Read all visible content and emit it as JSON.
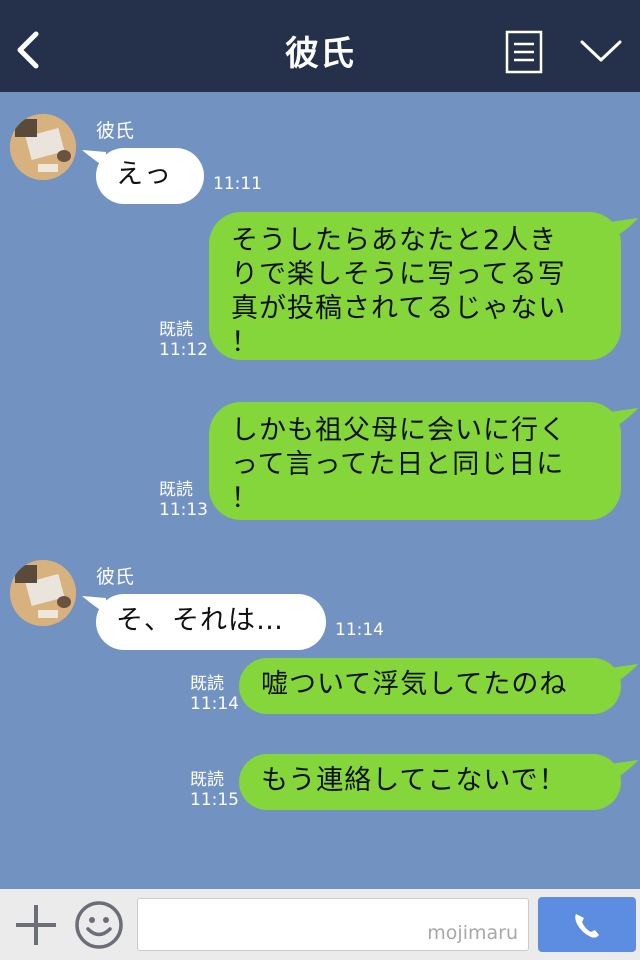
{
  "header": {
    "title": "彼氏",
    "back_icon": "chevron-left-icon",
    "menu_icon": "list-menu-icon",
    "collapse_icon": "chevron-down-icon"
  },
  "messages": [
    {
      "side": "in",
      "sender": "彼氏",
      "text": "えっ",
      "time": "11:11"
    },
    {
      "side": "out",
      "read": "既読",
      "time": "11:12",
      "text": "そうしたらあなたと2人き\nりで楽しそうに写ってる写\n真が投稿されてるじゃない\n！"
    },
    {
      "side": "out",
      "read": "既読",
      "time": "11:13",
      "text": "しかも祖父母に会いに行く\nって言ってた日と同じ日に\n！"
    },
    {
      "side": "in",
      "sender": "彼氏",
      "text": "そ、それは…",
      "time": "11:14"
    },
    {
      "side": "out",
      "read": "既読",
      "time": "11:14",
      "text": "嘘ついて浮気してたのね"
    },
    {
      "side": "out",
      "read": "既読",
      "time": "11:15",
      "text": "もう連絡してこないで！"
    }
  ],
  "footer": {
    "plus_icon": "plus-icon",
    "emoji_icon": "smiley-icon",
    "input_value": "",
    "watermark": "mojimaru",
    "send_icon": "phone-icon"
  },
  "colors": {
    "header_bg": "#25304a",
    "chat_bg": "#7293c2",
    "out_bubble": "#84d63a",
    "in_bubble": "#ffffff",
    "send_button": "#5c8de0"
  }
}
